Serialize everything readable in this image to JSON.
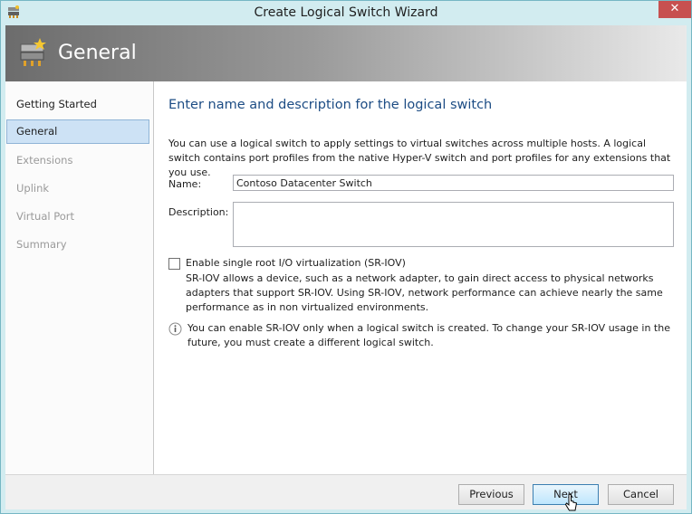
{
  "window": {
    "title": "Create Logical Switch Wizard",
    "close_glyph": "✕",
    "icon": "logical-switch-app-icon"
  },
  "header": {
    "title": "General",
    "icon": "logical-switch-header-icon"
  },
  "nav": {
    "items": [
      {
        "label": "Getting Started",
        "state": "done"
      },
      {
        "label": "General",
        "state": "active"
      },
      {
        "label": "Extensions",
        "state": "pending"
      },
      {
        "label": "Uplink",
        "state": "pending"
      },
      {
        "label": "Virtual Port",
        "state": "pending"
      },
      {
        "label": "Summary",
        "state": "pending"
      }
    ]
  },
  "main": {
    "heading": "Enter name and description for the logical switch",
    "description": "You can use a logical switch to apply settings to virtual switches across multiple hosts. A logical switch contains port profiles from the native Hyper-V switch and port profiles for any extensions that you use.",
    "name_label": "Name:",
    "name_value": "Contoso Datacenter Switch",
    "description_label": "Description:",
    "description_value": "",
    "sriov": {
      "checked": false,
      "label": "Enable single root I/O virtualization (SR-IOV)",
      "help": "SR-IOV allows a device, such as a network adapter, to gain direct access to physical networks adapters that support SR-IOV. Using SR-IOV, network performance can achieve nearly the same performance as in non virtualized environments."
    },
    "info_note": "You can enable SR-IOV only when a logical switch is created. To change your SR-IOV usage in the future, you must create a different logical switch."
  },
  "footer": {
    "previous_label": "Previous",
    "next_label": "Next",
    "cancel_label": "Cancel"
  },
  "colors": {
    "frame": "#d2ecf0",
    "heading": "#1c4c84",
    "nav_active": "#cde2f5",
    "close": "#c75050"
  }
}
